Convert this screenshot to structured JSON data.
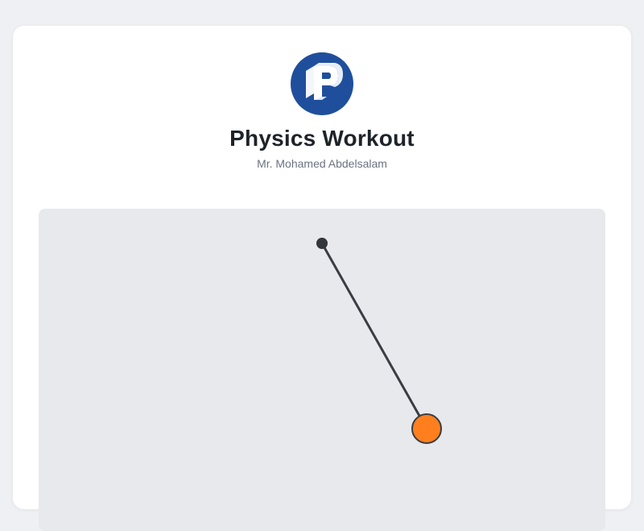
{
  "header": {
    "logo_icon": "p-logo-icon",
    "title": "Physics Workout",
    "subtitle": "Mr. Mohamed Abdelsalam"
  },
  "simulation": {
    "type": "pendulum",
    "colors": {
      "background": "#e7e9ed",
      "rod": "#3a3d42",
      "pivot": "#33363b",
      "bob": "#ff7f1e",
      "bob_stroke": "#3a3d42"
    }
  },
  "theme": {
    "page_background": "#eff0f4",
    "card_background": "#ffffff",
    "logo_color": "#1f4f9c"
  }
}
